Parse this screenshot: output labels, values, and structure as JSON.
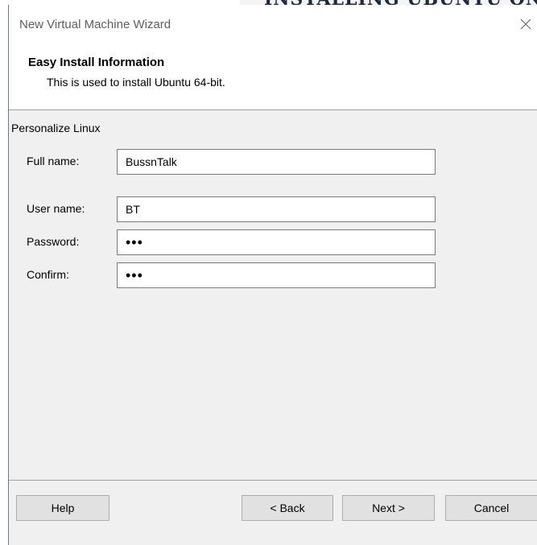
{
  "dialog": {
    "title": "New Virtual Machine Wizard",
    "close_icon": "close-icon"
  },
  "header": {
    "title": "Easy Install Information",
    "subtitle": "This is used to install Ubuntu 64-bit."
  },
  "personalize": {
    "section_label": "Personalize Linux",
    "full_name": {
      "label": "Full name:",
      "value": "BussnTalk"
    },
    "user_name": {
      "label": "User name:",
      "value": "BT"
    },
    "password": {
      "label": "Password:",
      "value": "•••"
    },
    "confirm": {
      "label": "Confirm:",
      "value": "•••"
    }
  },
  "footer": {
    "help_label": "Help",
    "back_label": "< Back",
    "next_label": "Next >",
    "cancel_label": "Cancel"
  }
}
